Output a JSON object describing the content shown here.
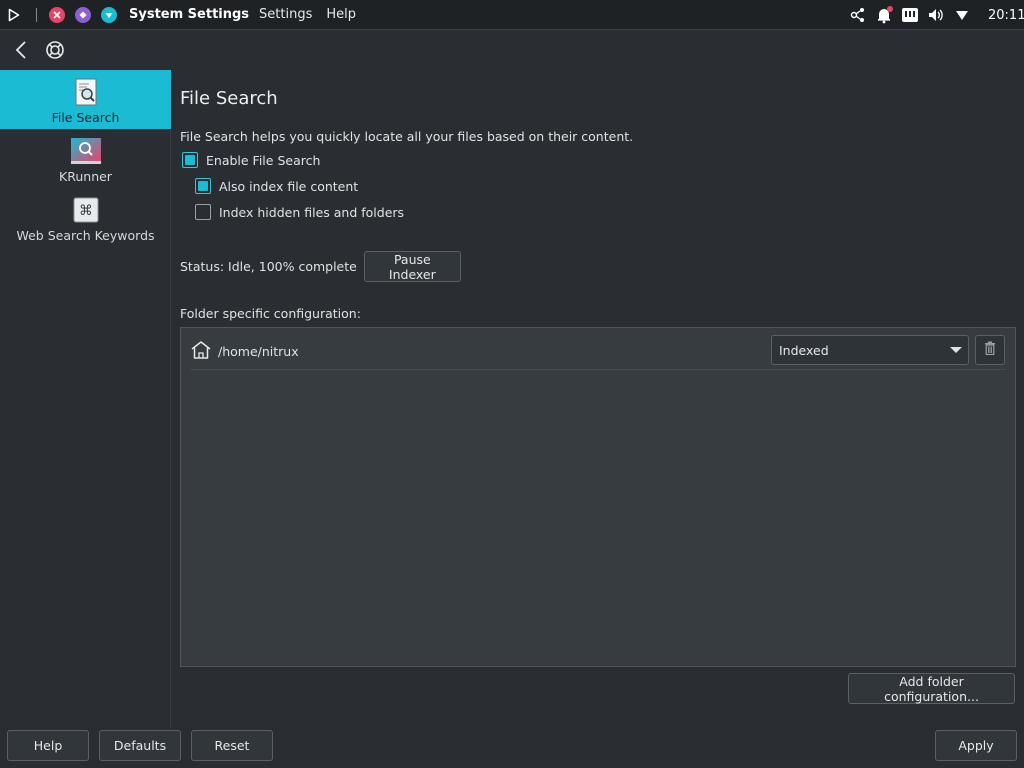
{
  "topbar": {
    "app_title": "System Settings",
    "menu": [
      "Settings",
      "Help"
    ],
    "clock": "20:11"
  },
  "sidebar": {
    "items": [
      {
        "label": "File Search",
        "active": true
      },
      {
        "label": "KRunner",
        "active": false
      },
      {
        "label": "Web Search Keywords",
        "active": false
      }
    ]
  },
  "main": {
    "title": "File Search",
    "description": "File Search helps you quickly locate all your files based on their content.",
    "enable_label": "Enable File Search",
    "enable_checked": true,
    "index_content_label": "Also index file content",
    "index_content_checked": true,
    "hidden_label": "Index hidden files and folders",
    "hidden_checked": false,
    "status_text": "Status: Idle, 100% complete",
    "pause_label": "Pause Indexer",
    "folder_config_label": "Folder specific configuration:",
    "folders": [
      {
        "path": "/home/nitrux",
        "mode": "Indexed"
      }
    ],
    "add_folder_label": "Add folder configuration..."
  },
  "bottom": {
    "help": "Help",
    "defaults": "Defaults",
    "reset": "Reset",
    "apply": "Apply"
  },
  "colors": {
    "accent": "#1bbbd4",
    "background": "#2a2e32",
    "panel": "#1f2225"
  }
}
